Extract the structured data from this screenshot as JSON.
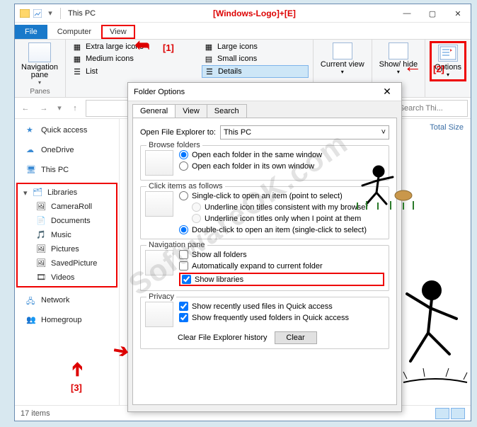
{
  "shortcut_hint": "[Windows-Logo]+[E]",
  "titlebar": {
    "title": "This PC"
  },
  "menutabs": {
    "file": "File",
    "computer": "Computer",
    "view": "View"
  },
  "ribbon": {
    "navigation_pane": "Navigation pane",
    "panes_group": "Panes",
    "layouts": {
      "extra_large": "Extra large icons",
      "large": "Large icons",
      "medium": "Medium icons",
      "small": "Small icons",
      "list": "List",
      "details": "Details"
    },
    "current_view": "Current view",
    "show_hide": "Show/ hide",
    "options": "Options"
  },
  "search": {
    "placeholder": "Search Thi..."
  },
  "sidebar": {
    "quick_access": "Quick access",
    "onedrive": "OneDrive",
    "this_pc": "This PC",
    "libraries": "Libraries",
    "library_items": {
      "camera": "CameraRoll",
      "documents": "Documents",
      "music": "Music",
      "pictures": "Pictures",
      "saved": "SavedPicture",
      "videos": "Videos"
    },
    "network": "Network",
    "homegroup": "Homegroup"
  },
  "columns": {
    "total_size": "Total Size"
  },
  "statusbar": {
    "items": "17 items"
  },
  "dialog": {
    "title": "Folder Options",
    "tabs": {
      "general": "General",
      "view": "View",
      "search": "Search"
    },
    "open_to_label": "Open File Explorer to:",
    "open_to_value": "This PC",
    "browse": {
      "legend": "Browse folders",
      "same": "Open each folder in the same window",
      "own": "Open each folder in its own window"
    },
    "click": {
      "legend": "Click items as follows",
      "single": "Single-click to open an item (point to select)",
      "und_browser": "Underline icon titles consistent with my browser",
      "und_point": "Underline icon titles only when I point at them",
      "double": "Double-click to open an item (single-click to select)"
    },
    "navpane": {
      "legend": "Navigation pane",
      "show_all": "Show all folders",
      "auto_expand": "Automatically expand to current folder",
      "show_lib": "Show libraries"
    },
    "privacy": {
      "legend": "Privacy",
      "recent_files": "Show recently used files in Quick access",
      "freq_folders": "Show frequently used folders in Quick access",
      "clear_label": "Clear File Explorer history",
      "clear_btn": "Clear"
    }
  },
  "annotations": {
    "1": "[1]",
    "2": "[2]",
    "3": "[3]"
  },
  "watermark": "SoftwareOK.com"
}
